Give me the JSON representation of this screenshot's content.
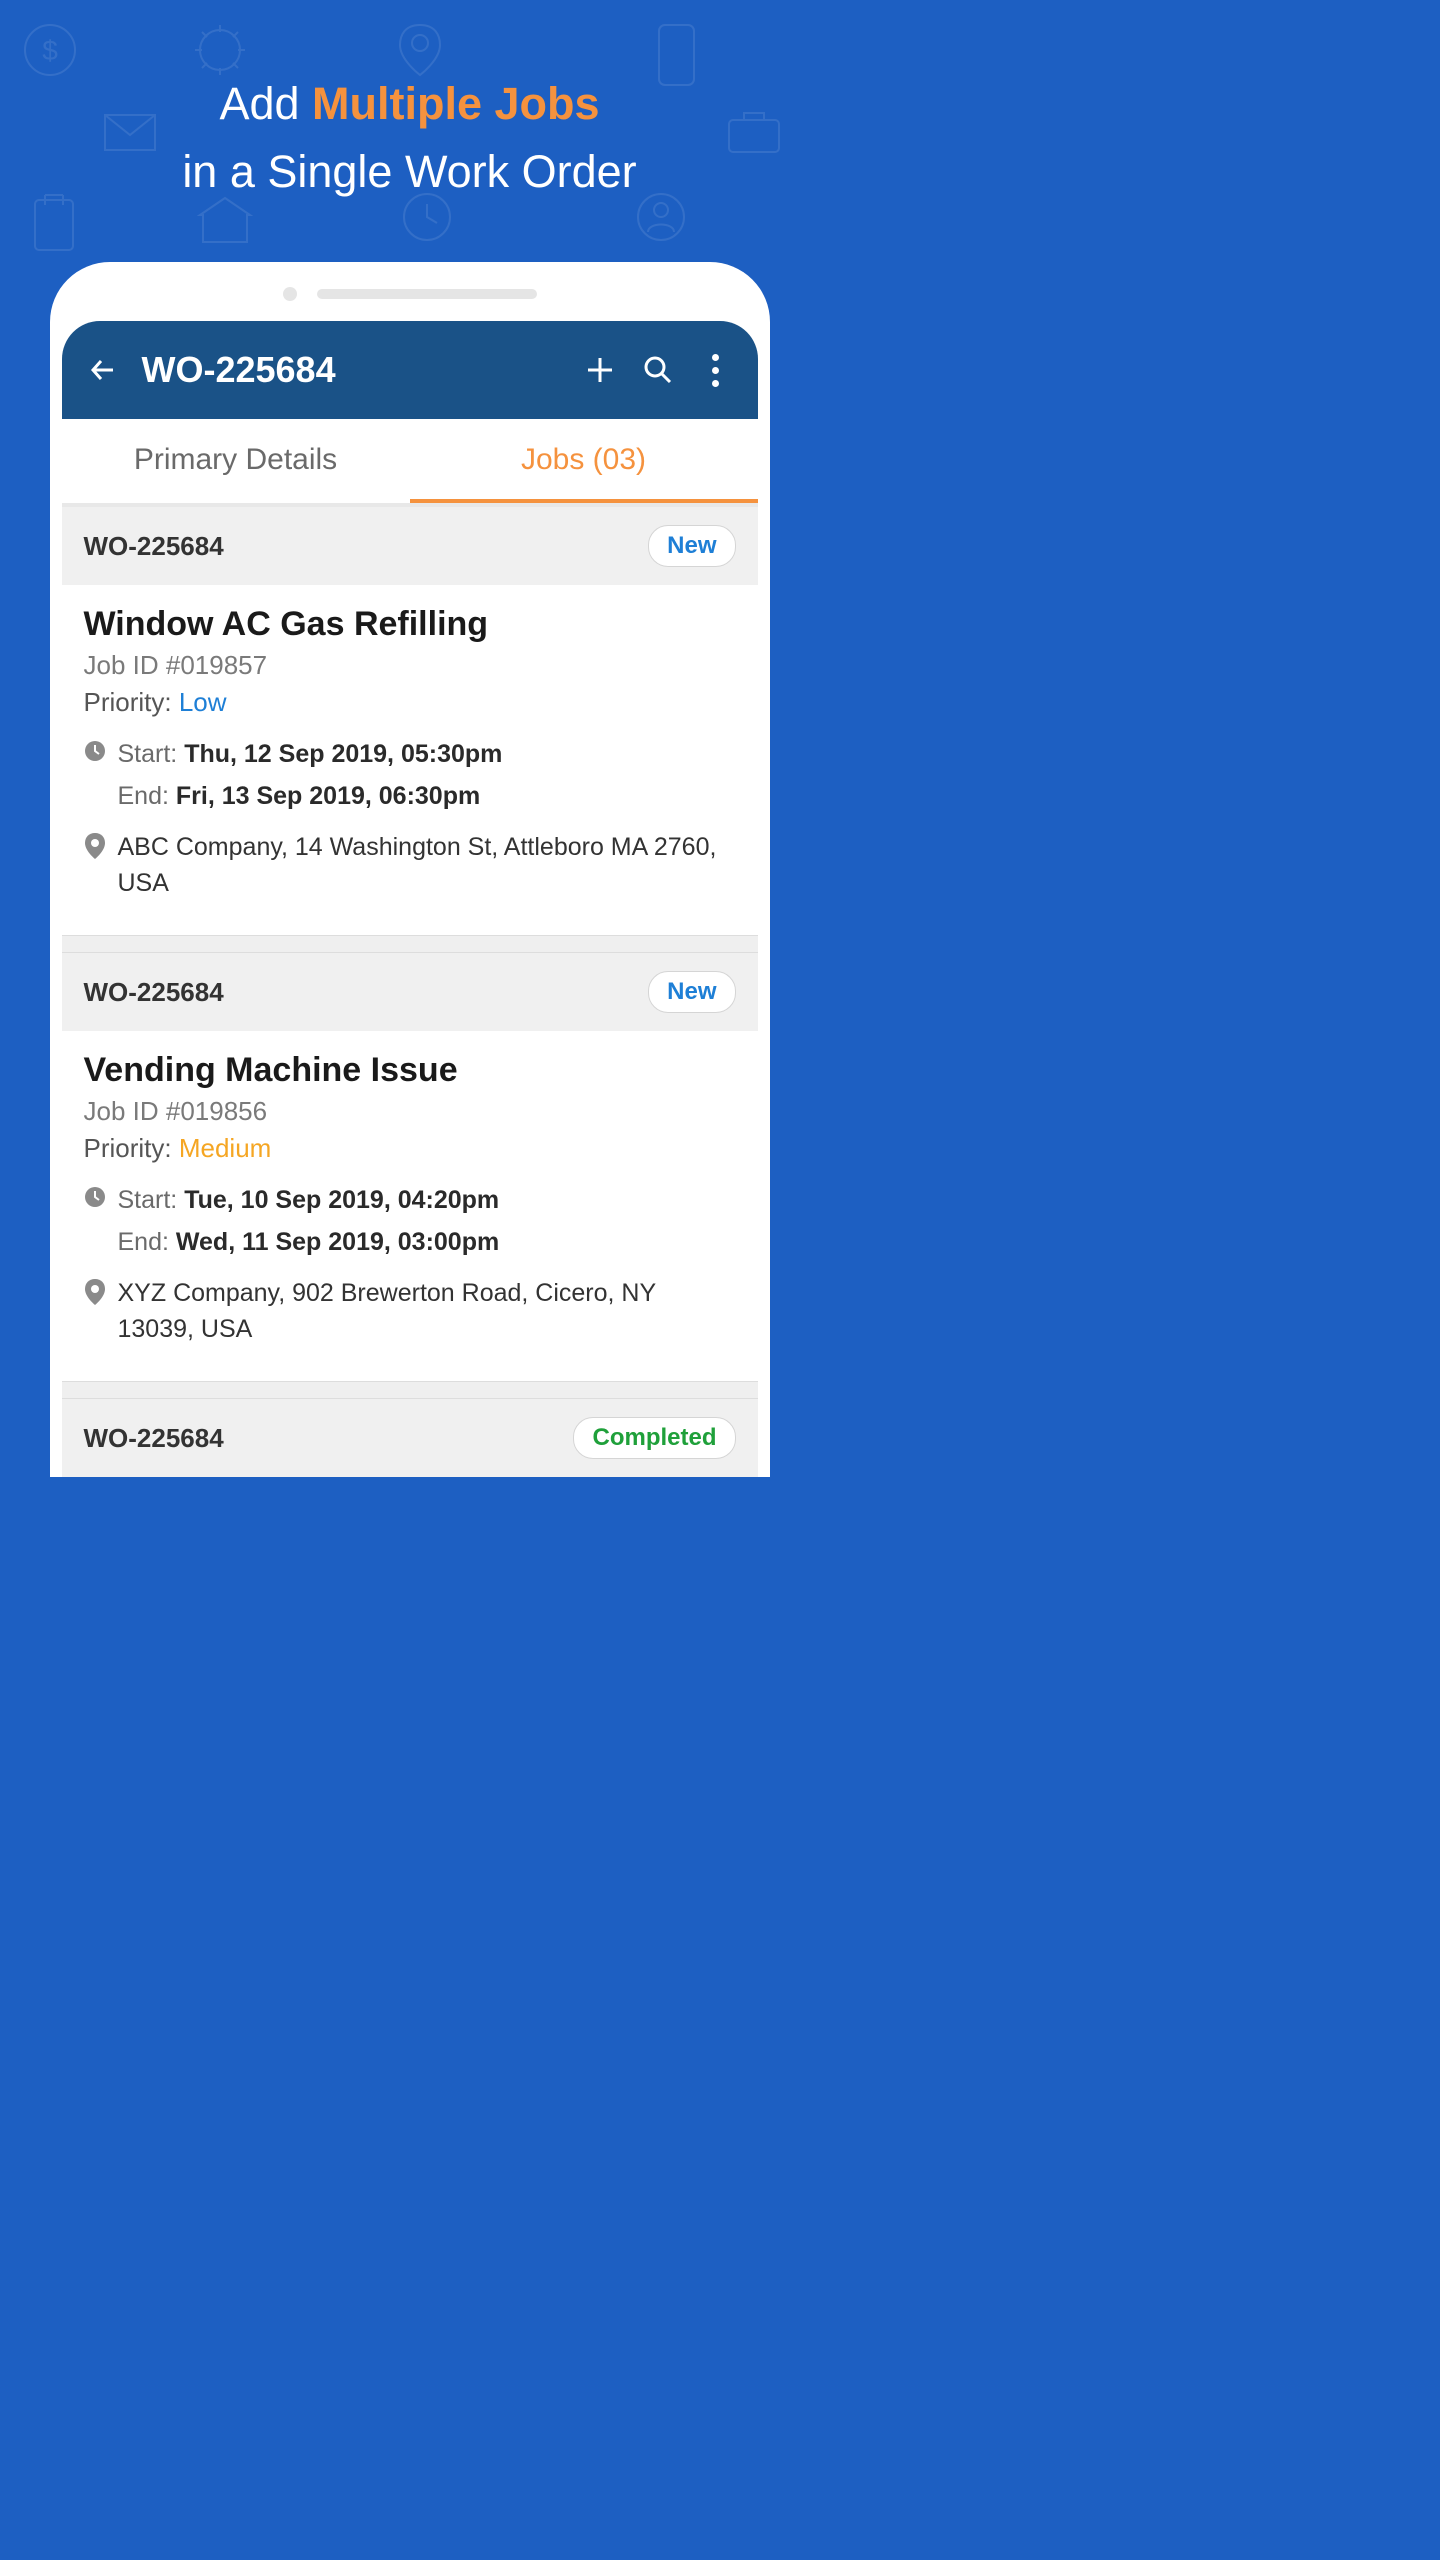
{
  "hero": {
    "prefix": "Add ",
    "accent": "Multiple Jobs",
    "suffix": "in a Single Work Order"
  },
  "header": {
    "title": "WO-225684"
  },
  "tabs": {
    "primary": "Primary Details",
    "jobs": "Jobs (03)"
  },
  "labels": {
    "priority": "Priority: ",
    "start": "Start: ",
    "end": "End: "
  },
  "jobs": [
    {
      "wo": "WO-225684",
      "status": "New",
      "status_class": "new",
      "title": "Window AC Gas Refilling",
      "job_id": "Job ID #019857",
      "priority": "Low",
      "priority_class": "low",
      "start": "Thu, 12 Sep 2019, 05:30pm",
      "end": "Fri, 13 Sep 2019, 06:30pm",
      "location": "ABC Company, 14 Washington St, Attleboro MA 2760, USA"
    },
    {
      "wo": "WO-225684",
      "status": "New",
      "status_class": "new",
      "title": "Vending Machine Issue",
      "job_id": "Job ID #019856",
      "priority": "Medium",
      "priority_class": "medium",
      "start": "Tue, 10 Sep 2019, 04:20pm",
      "end": "Wed, 11 Sep 2019, 03:00pm",
      "location": "XYZ Company, 902 Brewerton Road, Cicero, NY 13039, USA"
    },
    {
      "wo": "WO-225684",
      "status": "Completed",
      "status_class": "completed"
    }
  ]
}
